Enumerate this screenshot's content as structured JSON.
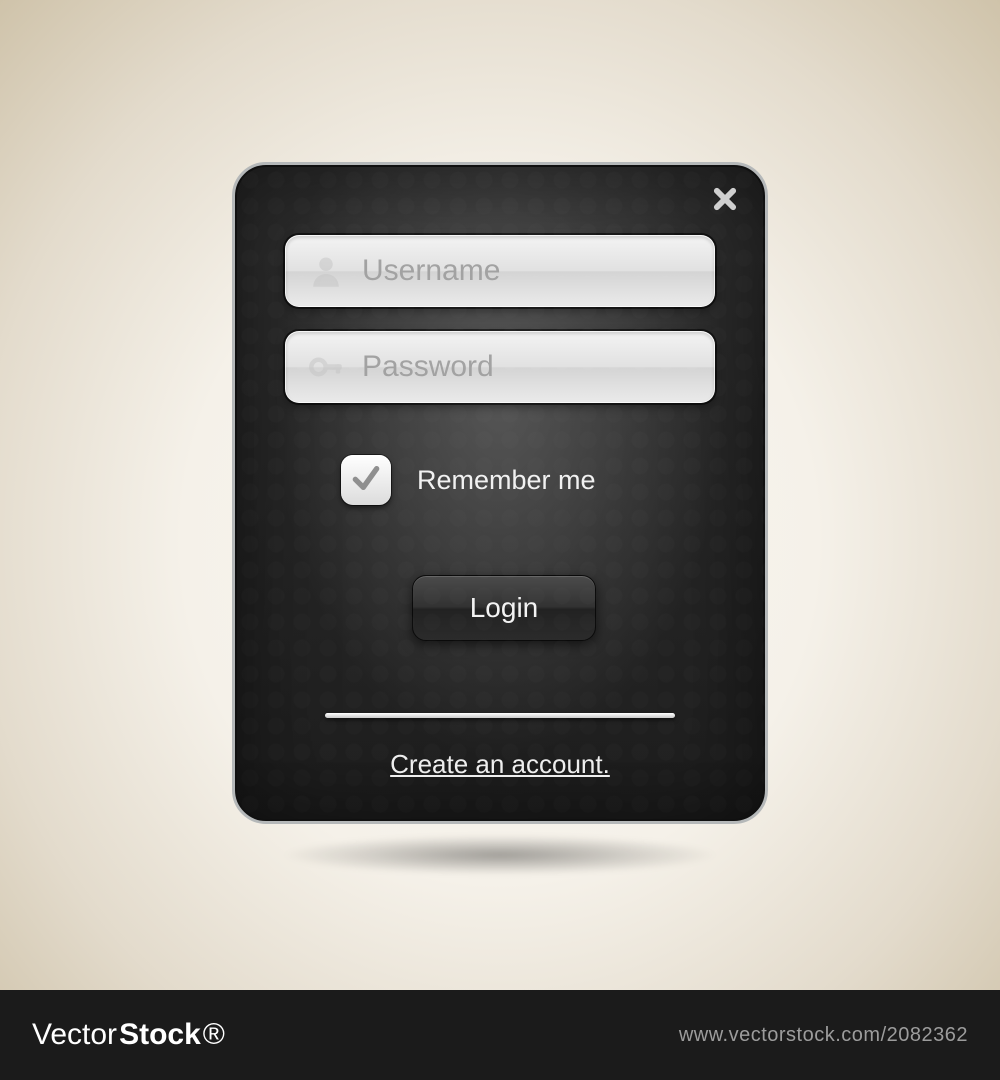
{
  "form": {
    "username": {
      "placeholder": "Username",
      "value": "",
      "icon": "user-icon"
    },
    "password": {
      "placeholder": "Password",
      "value": "",
      "icon": "key-icon"
    },
    "remember": {
      "label": "Remember me",
      "checked": true
    },
    "login_label": "Login",
    "create_account_label": "Create an account."
  },
  "footer": {
    "brand_vector": "Vector",
    "brand_stock": "Stock",
    "url": "www.vectorstock.com/2082362"
  },
  "colors": {
    "panel_bg": "#262626",
    "panel_border": "#b5b8b9",
    "field_text": "#a2a2a2",
    "button_bg": "#2f2f2f",
    "text_light": "#f1f1f1"
  }
}
